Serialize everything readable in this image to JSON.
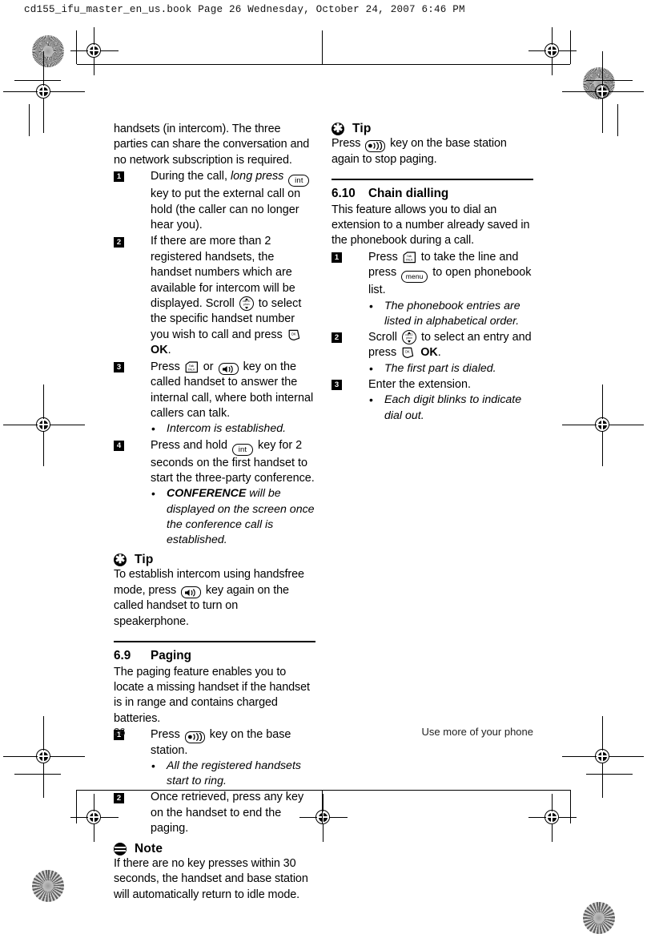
{
  "header": {
    "text": "cd155_ifu_master_en_us.book  Page 26  Wednesday, October 24, 2007  6:46 PM"
  },
  "left_column": {
    "intro": {
      "text": "handsets (in intercom). The three parties can share the conversation and no network subscription is required."
    },
    "steps": [
      {
        "num": "1",
        "parts": [
          {
            "t": "During the call, ",
            "style": "normal"
          },
          {
            "t": "long press",
            "style": "italic"
          },
          {
            "t": " ",
            "style": "normal"
          },
          {
            "t": "",
            "style": "key",
            "key": "int"
          },
          {
            "t": " key to put the external call on hold (the caller can no longer hear you).",
            "style": "normal"
          }
        ]
      },
      {
        "num": "2",
        "parts": [
          {
            "t": "If there are more than 2 registered handsets, the handset numbers which are available for intercom will be displayed. Scroll ",
            "style": "normal"
          },
          {
            "t": "",
            "style": "key",
            "key": "scroll"
          },
          {
            "t": " to select the specific handset number you wish to call and press ",
            "style": "normal"
          },
          {
            "t": "",
            "style": "key",
            "key": "ok"
          },
          {
            "t": " ",
            "style": "normal"
          },
          {
            "t": "OK",
            "style": "bold"
          },
          {
            "t": ".",
            "style": "normal"
          }
        ]
      },
      {
        "num": "3",
        "parts": [
          {
            "t": "Press ",
            "style": "normal"
          },
          {
            "t": "",
            "style": "key",
            "key": "talk"
          },
          {
            "t": " or ",
            "style": "normal"
          },
          {
            "t": "",
            "style": "key",
            "key": "speaker"
          },
          {
            "t": " key on the called handset to answer the internal call, where both internal callers can talk.",
            "style": "normal"
          }
        ],
        "bullets": [
          [
            {
              "t": "Intercom is established.",
              "style": "italic"
            }
          ]
        ]
      },
      {
        "num": "4",
        "parts": [
          {
            "t": "Press and hold ",
            "style": "normal"
          },
          {
            "t": "",
            "style": "key",
            "key": "int"
          },
          {
            "t": " key for 2 seconds on the first handset to start the three-party conference.",
            "style": "normal"
          }
        ],
        "bullets": [
          [
            {
              "t": "CONFERENCE",
              "style": "bold"
            },
            {
              "t": " will be displayed on the screen once the conference call is established.",
              "style": "italic"
            }
          ]
        ]
      }
    ],
    "tip": {
      "icon": "tip-asterisk-icon",
      "title": "Tip",
      "parts": [
        {
          "t": "To establish intercom using handsfree mode, press ",
          "style": "normal"
        },
        {
          "t": "",
          "style": "key",
          "key": "speaker"
        },
        {
          "t": " key again on the called handset to turn on speakerphone.",
          "style": "normal"
        }
      ]
    },
    "section": {
      "number": "6.9",
      "title": "Paging",
      "intro": "The paging feature enables you to locate a missing handset if the handset is in range and contains charged batteries.",
      "steps": [
        {
          "num": "1",
          "parts": [
            {
              "t": "Press ",
              "style": "normal"
            },
            {
              "t": "",
              "style": "key",
              "key": "page"
            },
            {
              "t": " key on the base station.",
              "style": "normal"
            }
          ],
          "bullets": [
            [
              {
                "t": "All the registered handsets start to ring.",
                "style": "italic"
              }
            ]
          ]
        },
        {
          "num": "2",
          "parts": [
            {
              "t": "Once retrieved, press any key on the handset to end the paging.",
              "style": "normal"
            }
          ]
        }
      ]
    },
    "note": {
      "icon": "note-lines-icon",
      "title": "Note",
      "text": "If there are no key presses within 30 seconds, the handset and base station will automatically return to idle mode."
    }
  },
  "right_column": {
    "tip": {
      "icon": "tip-asterisk-icon",
      "title": "Tip",
      "parts": [
        {
          "t": "Press ",
          "style": "normal"
        },
        {
          "t": "",
          "style": "key",
          "key": "page"
        },
        {
          "t": " key on the base station again to stop paging.",
          "style": "normal"
        }
      ]
    },
    "section": {
      "number": "6.10",
      "title": "Chain dialling",
      "intro": "This feature allows you to dial an extension to a number already saved in the phonebook during a call.",
      "steps": [
        {
          "num": "1",
          "parts": [
            {
              "t": "Press ",
              "style": "normal"
            },
            {
              "t": "",
              "style": "key",
              "key": "talk"
            },
            {
              "t": " to take the line and press ",
              "style": "normal"
            },
            {
              "t": "",
              "style": "key",
              "key": "menu"
            },
            {
              "t": " to open phonebook list.",
              "style": "normal"
            }
          ],
          "bullets": [
            [
              {
                "t": "The phonebook entries are listed in alphabetical order.",
                "style": "italic"
              }
            ]
          ]
        },
        {
          "num": "2",
          "parts": [
            {
              "t": "Scroll ",
              "style": "normal"
            },
            {
              "t": "",
              "style": "key",
              "key": "scroll"
            },
            {
              "t": " to select an entry and press ",
              "style": "normal"
            },
            {
              "t": "",
              "style": "key",
              "key": "ok"
            },
            {
              "t": " ",
              "style": "normal"
            },
            {
              "t": "OK",
              "style": "bold"
            },
            {
              "t": ".",
              "style": "normal"
            }
          ],
          "bullets": [
            [
              {
                "t": "The first part is dialed.",
                "style": "italic"
              }
            ]
          ]
        },
        {
          "num": "3",
          "parts": [
            {
              "t": "Enter the extension.",
              "style": "normal"
            }
          ],
          "bullets": [
            [
              {
                "t": "Each digit blinks to indicate dial out.",
                "style": "italic"
              }
            ]
          ]
        }
      ]
    }
  },
  "footer": {
    "page_number": "26",
    "running_title": "Use more of your phone"
  },
  "key_glyphs": {
    "int": "int",
    "menu": "menu",
    "scroll_top_label": "call ID",
    "scroll_bottom_label": "phon",
    "ok": "OK",
    "talk_top": "Talk",
    "talk_bottom": "TALK"
  },
  "bullet_char": "•"
}
